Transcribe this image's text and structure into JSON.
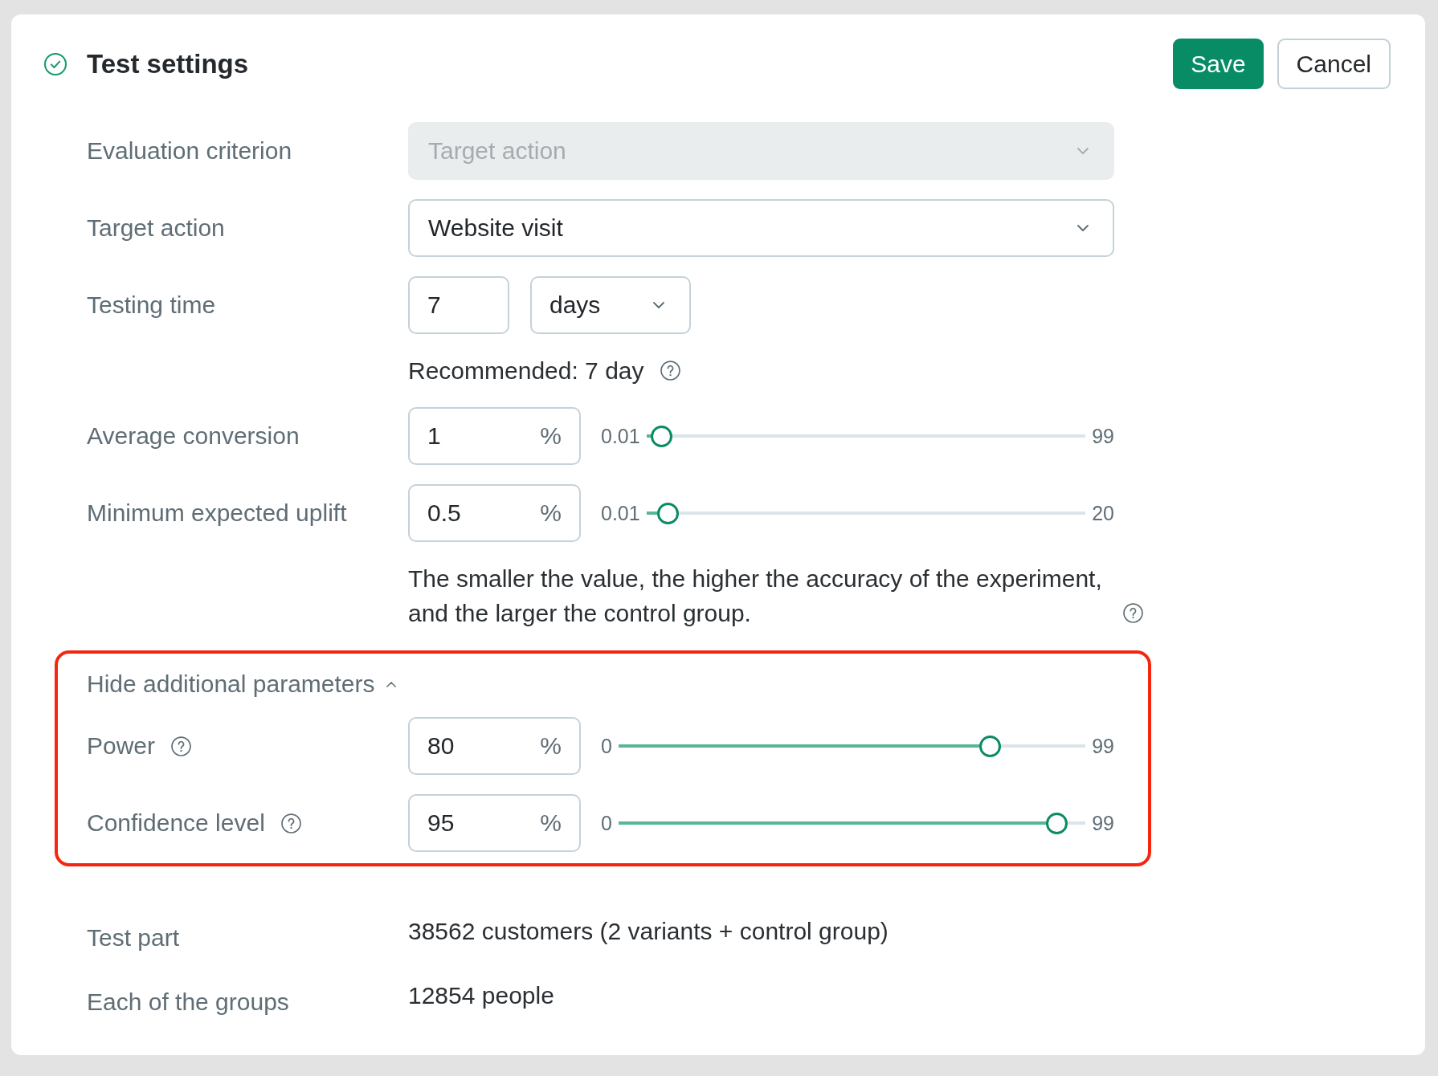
{
  "header": {
    "title": "Test settings"
  },
  "buttons": [
    {
      "label": "Save",
      "kind": "primary"
    },
    {
      "label": "Cancel",
      "kind": "secondary"
    }
  ],
  "fields": [
    {
      "kind": "select",
      "label": "Evaluation criterion",
      "value": "Target action",
      "disabled": true,
      "help": false
    },
    {
      "kind": "select",
      "label": "Target action",
      "value": "Website visit",
      "disabled": false,
      "help": false
    },
    {
      "kind": "duration",
      "label": "Testing time",
      "value": "7",
      "unit": "days",
      "disabled": false,
      "help": false
    },
    {
      "kind": "note",
      "text": "Recommended: 7 day",
      "disabled": false,
      "help": true
    },
    {
      "kind": "slider",
      "label": "Average conversion",
      "value": "1",
      "unit": "%",
      "min": "0.01",
      "max": "99",
      "level": 0.01,
      "disabled": false,
      "help": false
    },
    {
      "kind": "slider",
      "label": "Minimum expected uplift",
      "value": "0.5",
      "unit": "%",
      "min": "0.01",
      "max": "20",
      "level": 0.025,
      "disabled": false,
      "help": false
    },
    {
      "kind": "note",
      "text": "The smaller the value, the higher the accuracy of the experiment, and the larger the control group.",
      "disabled": false,
      "help": true
    }
  ],
  "advanced": {
    "toggle": "Hide additional parameters",
    "expanded": true,
    "highlighted": true,
    "fields": [
      {
        "kind": "slider",
        "label": "Power",
        "value": "80",
        "unit": "%",
        "min": "0",
        "max": "99",
        "level": 0.81,
        "disabled": false,
        "help": true
      },
      {
        "kind": "slider",
        "label": "Confidence level",
        "value": "95",
        "unit": "%",
        "min": "0",
        "max": "99",
        "level": 0.96,
        "disabled": false,
        "help": true
      }
    ]
  },
  "summary": [
    {
      "label": "Test part",
      "value": "38562 customers (2 variants + control group)"
    },
    {
      "label": "Each of the groups",
      "value": "12854 people"
    }
  ]
}
